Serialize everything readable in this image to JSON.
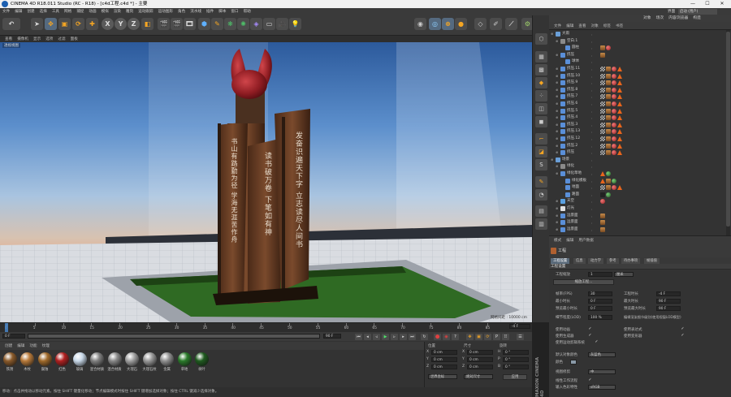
{
  "window": {
    "title": "CINEMA 4D R18.011 Studio (RC - R18) - [c4d工程.c4d *] - 主要",
    "min": "—",
    "max": "☐",
    "close": "✕"
  },
  "menu": [
    "文件",
    "编辑",
    "创建",
    "选择",
    "工具",
    "网格",
    "捕捉",
    "动画",
    "模拟",
    "渲染",
    "雕刻",
    "运动跟踪",
    "运动图形",
    "角色",
    "流水线",
    "插件",
    "脚本",
    "窗口",
    "帮助"
  ],
  "layout_label": "界面",
  "layout_value": "启动 (用户)",
  "viewport": {
    "menu": [
      "查看",
      "摄像机",
      "显示",
      "选项",
      "过滤",
      "面板"
    ],
    "label": "透视视图",
    "grid_status": "网格间距 : 10000 cm",
    "monument_left": "书山有路勤为径 学海无涯苦作舟",
    "monument_mid": "读书破万卷 下笔如有神",
    "monument_right": "发奋识遍天下字 立志读尽人间书"
  },
  "object_manager": {
    "tabs": [
      "对象",
      "场次",
      "内容浏览器",
      "构造"
    ],
    "menu": [
      "文件",
      "编辑",
      "查看",
      "对象",
      "标签",
      "书签"
    ],
    "objects": [
      {
        "name": "大雨",
        "indent": 0,
        "icon": "#6a9fd8",
        "tags": []
      },
      {
        "name": "空白.1",
        "indent": 1,
        "icon": "#8a8a8a",
        "tags": []
      },
      {
        "name": "圆柱",
        "indent": 2,
        "icon": "#5a8fd8",
        "tags": [
          "wood",
          "sphere"
        ]
      },
      {
        "name": "挤压",
        "indent": 1,
        "icon": "#5a8fd8",
        "tags": [
          "wood"
        ]
      },
      {
        "name": "球体",
        "indent": 2,
        "icon": "#5a8fd8",
        "tags": []
      },
      {
        "name": "挤压.11",
        "indent": 1,
        "icon": "#5a8fd8",
        "tags": [
          "check",
          "wood",
          "sphere",
          "tri"
        ]
      },
      {
        "name": "挤压.10",
        "indent": 1,
        "icon": "#5a8fd8",
        "tags": [
          "check",
          "wood",
          "sphere",
          "tri"
        ]
      },
      {
        "name": "挤压.9",
        "indent": 1,
        "icon": "#5a8fd8",
        "tags": [
          "check",
          "wood",
          "sphere",
          "tri"
        ]
      },
      {
        "name": "挤压.8",
        "indent": 1,
        "icon": "#5a8fd8",
        "tags": [
          "check",
          "wood",
          "sphere",
          "tri"
        ]
      },
      {
        "name": "挤压.7",
        "indent": 1,
        "icon": "#5a8fd8",
        "tags": [
          "check",
          "wood",
          "sphere",
          "tri"
        ]
      },
      {
        "name": "挤压.6",
        "indent": 1,
        "icon": "#5a8fd8",
        "tags": [
          "check",
          "wood",
          "sphere",
          "tri"
        ]
      },
      {
        "name": "挤压.5",
        "indent": 1,
        "icon": "#5a8fd8",
        "tags": [
          "check",
          "wood",
          "sphere",
          "tri"
        ]
      },
      {
        "name": "挤压.4",
        "indent": 1,
        "icon": "#5a8fd8",
        "tags": [
          "check",
          "wood",
          "sphere",
          "tri"
        ]
      },
      {
        "name": "挤压.3",
        "indent": 1,
        "icon": "#5a8fd8",
        "tags": [
          "check",
          "wood",
          "sphere",
          "tri"
        ]
      },
      {
        "name": "挤压.13",
        "indent": 1,
        "icon": "#5a8fd8",
        "tags": [
          "check",
          "wood",
          "sphere",
          "tri"
        ]
      },
      {
        "name": "挤压.12",
        "indent": 1,
        "icon": "#5a8fd8",
        "tags": [
          "check",
          "wood",
          "sphere",
          "tri"
        ]
      },
      {
        "name": "挤压.2",
        "indent": 1,
        "icon": "#5a8fd8",
        "tags": [
          "check",
          "wood",
          "sphere",
          "tri"
        ]
      },
      {
        "name": "挤压",
        "indent": 1,
        "icon": "#5a8fd8",
        "tags": [
          "check",
          "wood",
          "sphere",
          "tri"
        ]
      },
      {
        "name": "场景",
        "indent": 0,
        "icon": "#6a9fd8",
        "tags": []
      },
      {
        "name": "绿化",
        "indent": 1,
        "icon": "#8a8a8a",
        "tags": []
      },
      {
        "name": "绿化草地",
        "indent": 1,
        "icon": "#5a8fd8",
        "tags": [
          "tri",
          "green"
        ]
      },
      {
        "name": "绿化模板",
        "indent": 2,
        "icon": "#5a8fd8",
        "tags": [
          "tri",
          "wood",
          "green"
        ]
      },
      {
        "name": "地面",
        "indent": 2,
        "icon": "#5a8fd8",
        "tags": [
          "check",
          "wood",
          "sphere",
          "tri"
        ]
      },
      {
        "name": "路面",
        "indent": 2,
        "icon": "#5a8fd8",
        "tags": [
          "dark",
          "green"
        ]
      },
      {
        "name": "天空",
        "indent": 1,
        "icon": "#5aa0e0",
        "tags": [
          "sphere"
        ]
      },
      {
        "name": "灯光",
        "indent": 1,
        "icon": "#e0e0e0",
        "tags": []
      },
      {
        "name": "远景面",
        "indent": 1,
        "icon": "#5a8fd8",
        "tags": [
          "wood"
        ]
      },
      {
        "name": "远景面",
        "indent": 1,
        "icon": "#5a8fd8",
        "tags": [
          "wood"
        ]
      },
      {
        "name": "远景面",
        "indent": 1,
        "icon": "#5a8fd8",
        "tags": [
          "wood"
        ]
      }
    ]
  },
  "attribute_manager": {
    "tabs": [
      "模式",
      "编辑",
      "用户数据"
    ],
    "header": "工程",
    "subtabs": [
      "工程设置",
      "信息",
      "动力学",
      "参考",
      "待办事项",
      "帧插值"
    ],
    "section": "工程设置",
    "scale_label": "工程缩放",
    "scale_value": "1",
    "scale_unit": "厘米",
    "scale_button": "缩放工程...",
    "fps_label": "帧率(FPS)",
    "fps_value": "30",
    "mintime_label": "最小时长",
    "mintime_value": "0 F",
    "previewmin_label": "预览最小时长",
    "previewmin_value": "0 F",
    "lod_label": "细节程度(LOD)",
    "lod_value": "100 %",
    "projtime_label": "工程时长",
    "projtime_value": "-4 F",
    "maxtime_label": "最大时长",
    "maxtime_value": "90 F",
    "previewmax_label": "预览最大时长",
    "previewmax_value": "90 F",
    "renderlod_label": "编辑渲染细节级别(使用视窗LOD模型)",
    "anim_label": "使用动画",
    "expr_label": "使用表达式",
    "gen_label": "使用生成器",
    "deform_label": "使用变形器",
    "motion_label": "使用运动剪辑系统",
    "objcolor_label": "默认对象颜色",
    "objcolor_value": "灰蓝色",
    "color_label": "颜色",
    "viewclip_label": "视图修剪",
    "viewclip_value": "中",
    "linear_label": "线性工作流程",
    "colorprofile_label": "输入色彩特性",
    "colorprofile_value": "sRGB"
  },
  "timeline": {
    "ticks": [
      "0",
      "5",
      "10",
      "15",
      "20",
      "25",
      "30",
      "35",
      "40",
      "45",
      "50",
      "55",
      "60",
      "65",
      "70",
      "75",
      "80",
      "85",
      "90"
    ],
    "end_frame": "-4 F",
    "start_field": "0 F",
    "current_field": "0 F",
    "end_field": "90 F",
    "max_field": "90 F"
  },
  "material_manager": {
    "menu": [
      "创建",
      "编辑",
      "功能",
      "纹理"
    ],
    "materials": [
      {
        "name": "铁锈",
        "color": "#8a5a2a"
      },
      {
        "name": "木纹",
        "color": "#b87a3a"
      },
      {
        "name": "腐蚀",
        "color": "#a06a2a"
      },
      {
        "name": "红色",
        "color": "#b02020"
      },
      {
        "name": "玻璃",
        "color": "#c8d8e8"
      },
      {
        "name": "混合材质",
        "color": "#808080"
      },
      {
        "name": "混合材质",
        "color": "#888888"
      },
      {
        "name": "大理石",
        "color": "#a0a0a0"
      },
      {
        "name": "大理石纹",
        "color": "#989898"
      },
      {
        "name": "金属",
        "color": "#909090"
      },
      {
        "name": "草地",
        "color": "#2a7a2a"
      },
      {
        "name": "树叶",
        "color": "#1f5a1f"
      }
    ]
  },
  "coords": {
    "headers": [
      "位置",
      "尺寸",
      "旋转"
    ],
    "rows": [
      {
        "a": "X",
        "av": "0 cm",
        "b": "X",
        "bv": "0 cm",
        "c": "H",
        "cv": "0 °"
      },
      {
        "a": "Y",
        "av": "0 cm",
        "b": "Y",
        "bv": "0 cm",
        "c": "P",
        "cv": "0 °"
      },
      {
        "a": "Z",
        "av": "0 cm",
        "b": "Z",
        "bv": "0 cm",
        "c": "B",
        "cv": "0 °"
      }
    ],
    "mode": "世界坐标",
    "size_mode": "绝对尺寸",
    "apply": "应用"
  },
  "status_text": "移动：点击并拖动以移动元素。按住 SHIFT 键量化移动；节点编辑模式时按住 SHIFT 键增加选择对象；按住 CTRL 键减少选择对象。",
  "brand": "MAXON CINEMA 4D"
}
